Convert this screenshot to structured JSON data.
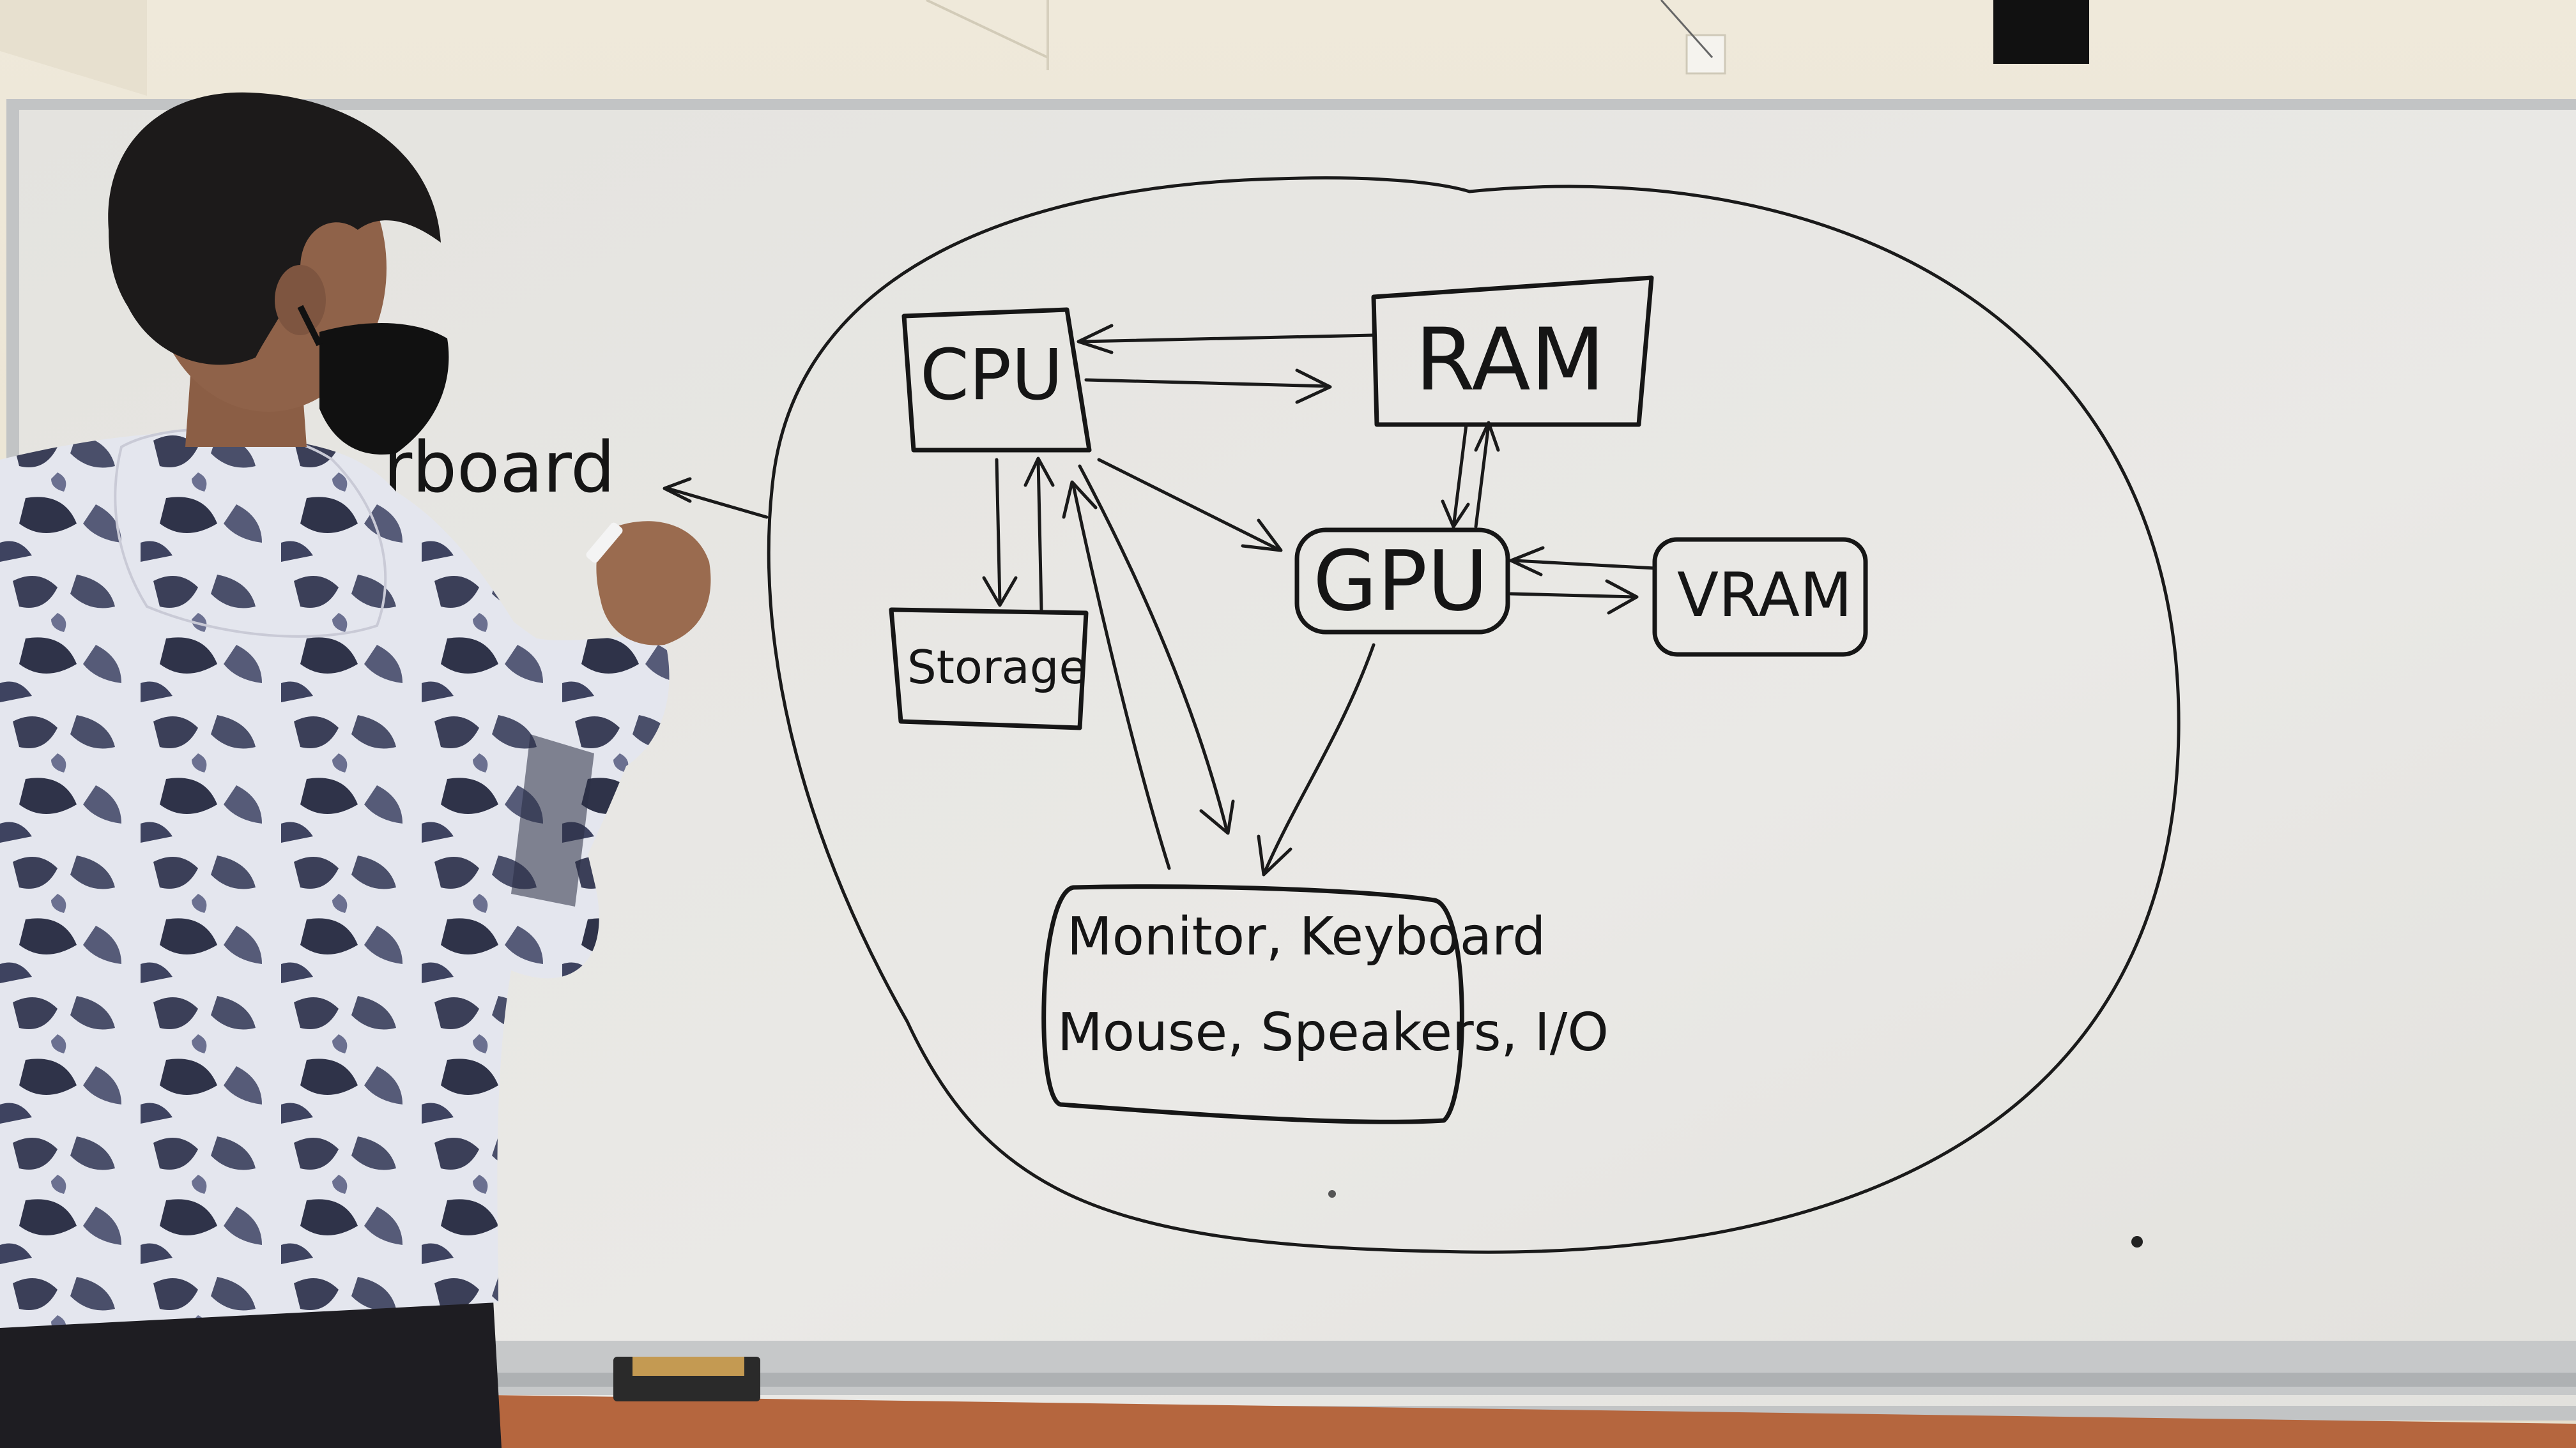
{
  "diagram": {
    "nodes": {
      "cpu": "CPU",
      "ram": "RAM",
      "gpu": "GPU",
      "vram": "VRAM",
      "storage": "Storage",
      "io_line1": "Monitor, Keyboard",
      "io_line2": "Mouse, Speakers, I/O"
    },
    "partial_label": "rboard"
  },
  "colors": {
    "wall": "#ece6d7",
    "whiteboard": "#e8e8e5",
    "frame": "#b9bcbd",
    "marker": "#161616",
    "floor": "#b5663e",
    "hoodie_light": "#e6e8ee",
    "hoodie_dark": "#3b3f58",
    "hair": "#1c1a1a",
    "mask": "#111111"
  }
}
